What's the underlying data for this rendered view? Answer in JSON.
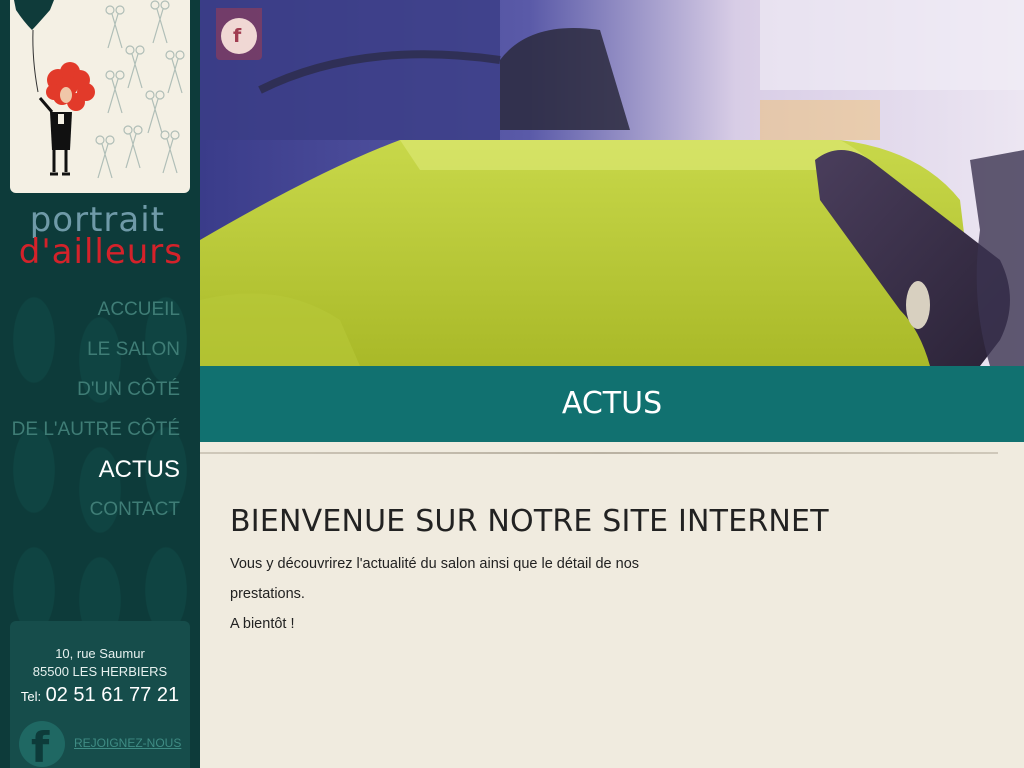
{
  "brand": {
    "line1": "portrait",
    "line2": "d'ailleurs"
  },
  "nav": {
    "items": [
      {
        "label": "ACCUEIL"
      },
      {
        "label": "LE SALON"
      },
      {
        "label": "D'UN CÔTÉ"
      },
      {
        "label": "DE L'AUTRE CÔTÉ"
      },
      {
        "label": "ACTUS",
        "active": true
      },
      {
        "label": "CONTACT"
      }
    ]
  },
  "contact": {
    "street": "10, rue Saumur",
    "city": "85500 LES HERBIERS",
    "tel_label": "Tel:",
    "tel_number": "02 51 61 77 21",
    "facebook_icon": "facebook-icon",
    "join_label": "REJOIGNEZ-NOUS"
  },
  "header": {
    "facebook_icon": "facebook-icon"
  },
  "page": {
    "title": "ACTUS"
  },
  "article": {
    "heading": "BIENVENUE SUR NOTRE SITE INTERNET",
    "paragraph1_line1": "Vous y découvrirez l'actualité du salon ainsi que le détail de nos",
    "paragraph1_line2": "prestations.",
    "paragraph2": "A bientôt !"
  },
  "colors": {
    "sidebar_bg": "#0d3b3a",
    "title_bar": "#117170",
    "nav_text": "#3f7d76",
    "nav_active": "#ffffff",
    "brand_blue": "#6f9aa8",
    "brand_red": "#d4222a",
    "content_bg": "#f0ebdf"
  }
}
